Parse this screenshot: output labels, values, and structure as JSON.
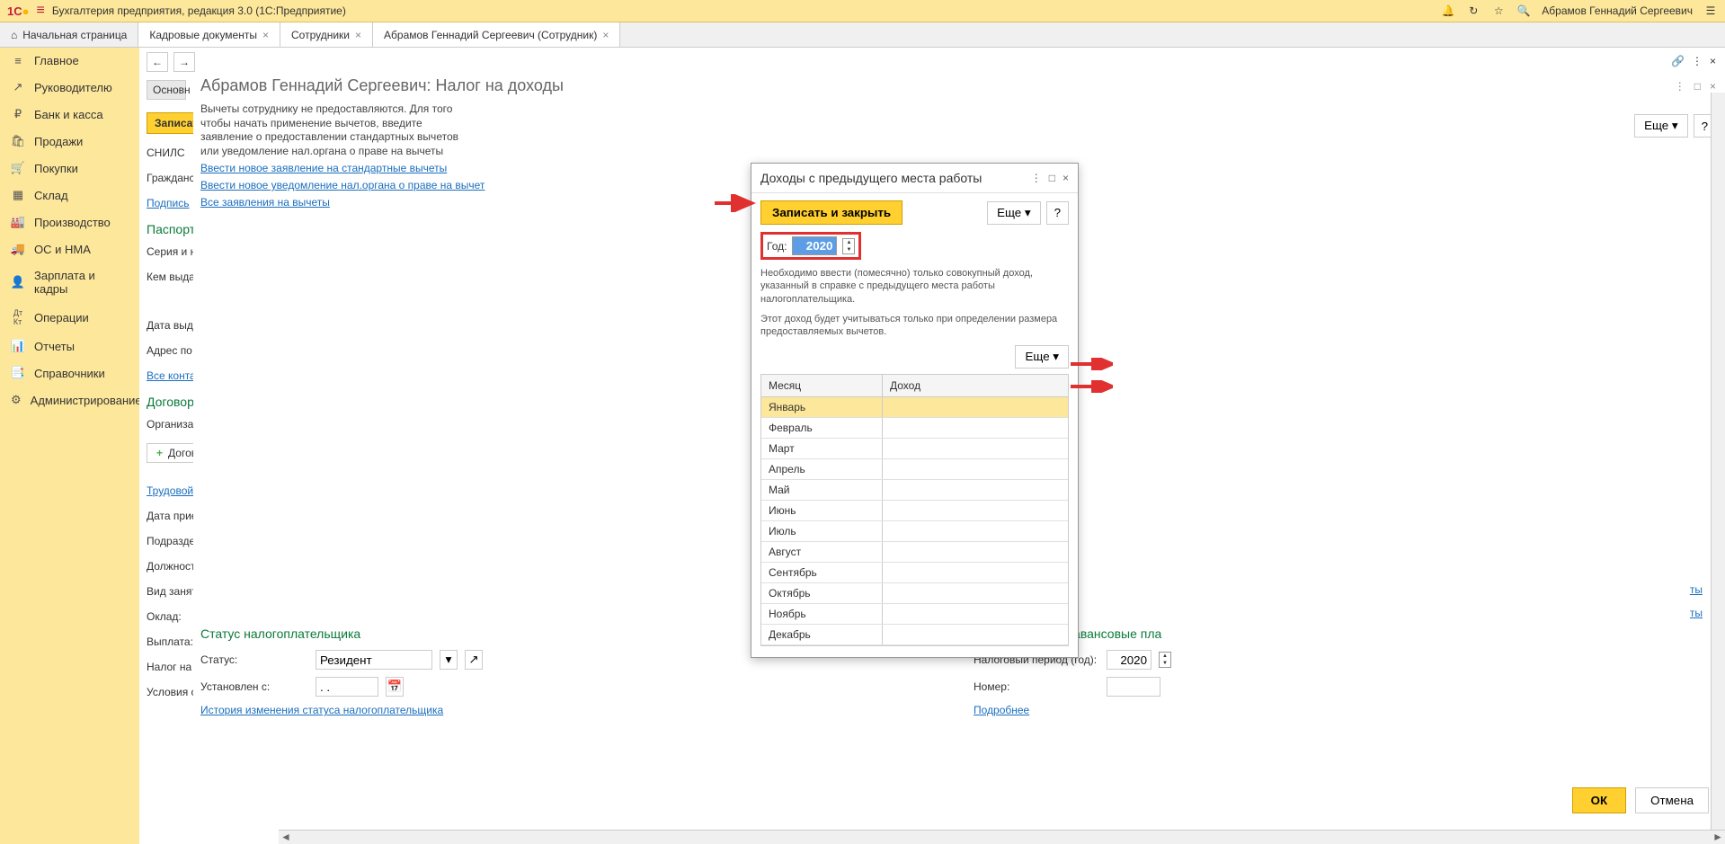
{
  "titlebar": {
    "logo": "1C",
    "title": "Бухгалтерия предприятия, редакция 3.0  (1С:Предприятие)",
    "user": "Абрамов Геннадий Сергеевич"
  },
  "tabs": {
    "home": "Начальная страница",
    "items": [
      "Кадровые документы",
      "Сотрудники",
      "Абрамов Геннадий Сергеевич (Сотрудник)"
    ]
  },
  "sidebar": {
    "items": [
      {
        "icon": "≡",
        "label": "Главное"
      },
      {
        "icon": "↗",
        "label": "Руководителю"
      },
      {
        "icon": "₽",
        "label": "Банк и касса"
      },
      {
        "icon": "🛍",
        "label": "Продажи"
      },
      {
        "icon": "🛒",
        "label": "Покупки"
      },
      {
        "icon": "📦",
        "label": "Склад"
      },
      {
        "icon": "🏭",
        "label": "Производство"
      },
      {
        "icon": "🚚",
        "label": "ОС и НМА"
      },
      {
        "icon": "👤",
        "label": "Зарплата и кадры"
      },
      {
        "icon": "дт/кт",
        "label": "Операции"
      },
      {
        "icon": "📊",
        "label": "Отчеты"
      },
      {
        "icon": "📑",
        "label": "Справочники"
      },
      {
        "icon": "⚙",
        "label": "Администрирование"
      }
    ]
  },
  "left_panel": {
    "tab": "Основн",
    "save": "Записат",
    "snils": "СНИЛС",
    "citizen": "Гражданс",
    "sign": "Подпись",
    "passport_heading": "Паспорт",
    "series": "Серия и н",
    "issued": "Кем выдан",
    "date": "Дата выда",
    "address": "Адрес по",
    "all_contacts": "Все конта",
    "contract_heading": "Договорн",
    "org": "Организа",
    "add_contract": "Догов",
    "labor": "Трудовой д",
    "hire_date": "Дата прие",
    "dept": "Подраздел",
    "position": "Должность",
    "employment": "Вид занят",
    "salary": "Оклад:",
    "payment": "Выплата:",
    "tax": "Налог на д",
    "conditions": "Условия ст"
  },
  "main_panel": {
    "title": "Абрамов Геннадий Сергеевич: Налог на доходы",
    "info": "Вычеты сотруднику не предоставляются. Для того чтобы начать применение вычетов, введите заявление о предоставлении стандартных вычетов или уведомление нал.органа о праве на вычеты",
    "link1": "Ввести новое заявление на стандартные вычеты",
    "link2": "Ввести новое уведомление нал.органа о праве на вычет",
    "link3": "Все заявления на вычеты",
    "status_heading": "Статус налогоплательщика",
    "status_label": "Статус:",
    "status_value": "Резидент",
    "set_from_label": "Установлен с:",
    "set_from_value": ". .",
    "history_link": "История изменения статуса налогоплательщика",
    "advance_heading": "Уведомление на авансовые пла",
    "tax_period_label": "Налоговый период (год):",
    "tax_period_value": "2020",
    "number_label": "Номер:",
    "more_link": "Подробнее",
    "more_btn": "Еще ▾",
    "help_btn": "?",
    "right_link1": "ты",
    "right_link2": "ты"
  },
  "dialog": {
    "title": "Доходы с предыдущего места работы",
    "save_btn": "Записать и закрыть",
    "more_btn": "Еще ▾",
    "help_btn": "?",
    "year_label": "Год:",
    "year_value": "2020",
    "info1": "Необходимо ввести (помесячно) только совокупный доход, указанный в справке с предыдущего места работы налогоплательщика.",
    "info2": "Этот доход будет учитываться только при определении размера предоставляемых вычетов.",
    "col_month": "Месяц",
    "col_income": "Доход",
    "months": [
      "Январь",
      "Февраль",
      "Март",
      "Апрель",
      "Май",
      "Июнь",
      "Июль",
      "Август",
      "Сентябрь",
      "Октябрь",
      "Ноябрь",
      "Декабрь"
    ]
  },
  "buttons": {
    "ok": "ОК",
    "cancel": "Отмена"
  }
}
